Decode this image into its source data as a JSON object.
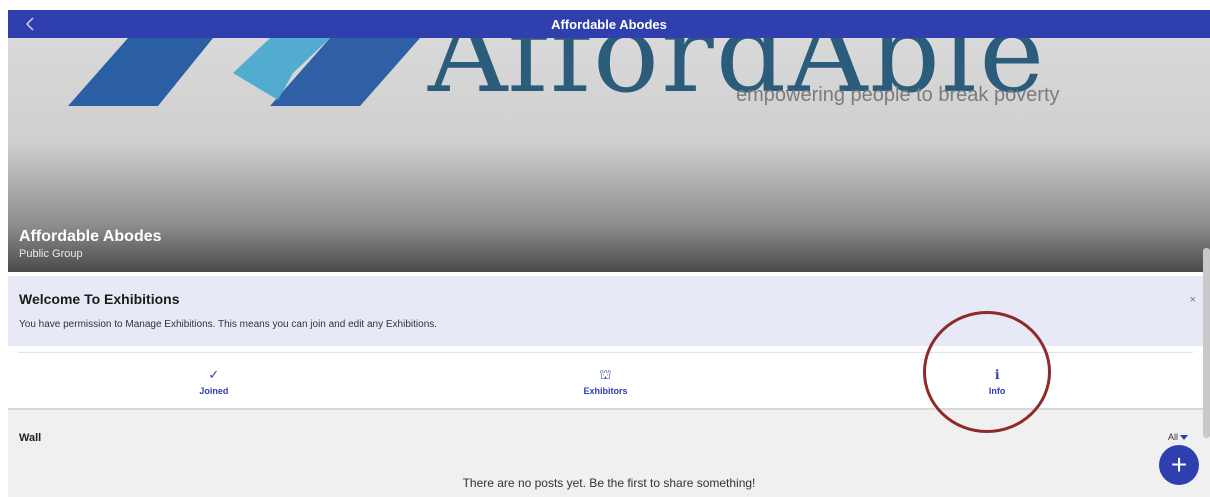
{
  "header": {
    "title": "Affordable Abodes",
    "back_icon": "chevron-left-icon"
  },
  "cover": {
    "logo_text": "AffordAble",
    "tagline": "empowering people to break poverty",
    "group_name": "Affordable Abodes",
    "group_type": "Public Group"
  },
  "welcome": {
    "heading": "Welcome To Exhibitions",
    "message": "You have permission to Manage Exhibitions. This means you can join and edit any Exhibitions.",
    "close_glyph": "×"
  },
  "tabs": [
    {
      "label": "Joined",
      "glyph": "✓",
      "icon": "checkmark-icon"
    },
    {
      "label": "Exhibitors",
      "glyph": "⛫",
      "icon": "exhibitors-icon"
    },
    {
      "label": "Info",
      "glyph": "ℹ",
      "icon": "info-icon"
    }
  ],
  "wall": {
    "title": "Wall",
    "filter_label": "All",
    "empty_message": "There are no posts yet. Be the first to share something!"
  },
  "fab": {
    "glyph": "+",
    "icon": "plus-icon"
  },
  "colors": {
    "primary": "#2f3fae",
    "welcome_bg": "#e7e9f6",
    "annotation": "#8e2a2a"
  }
}
